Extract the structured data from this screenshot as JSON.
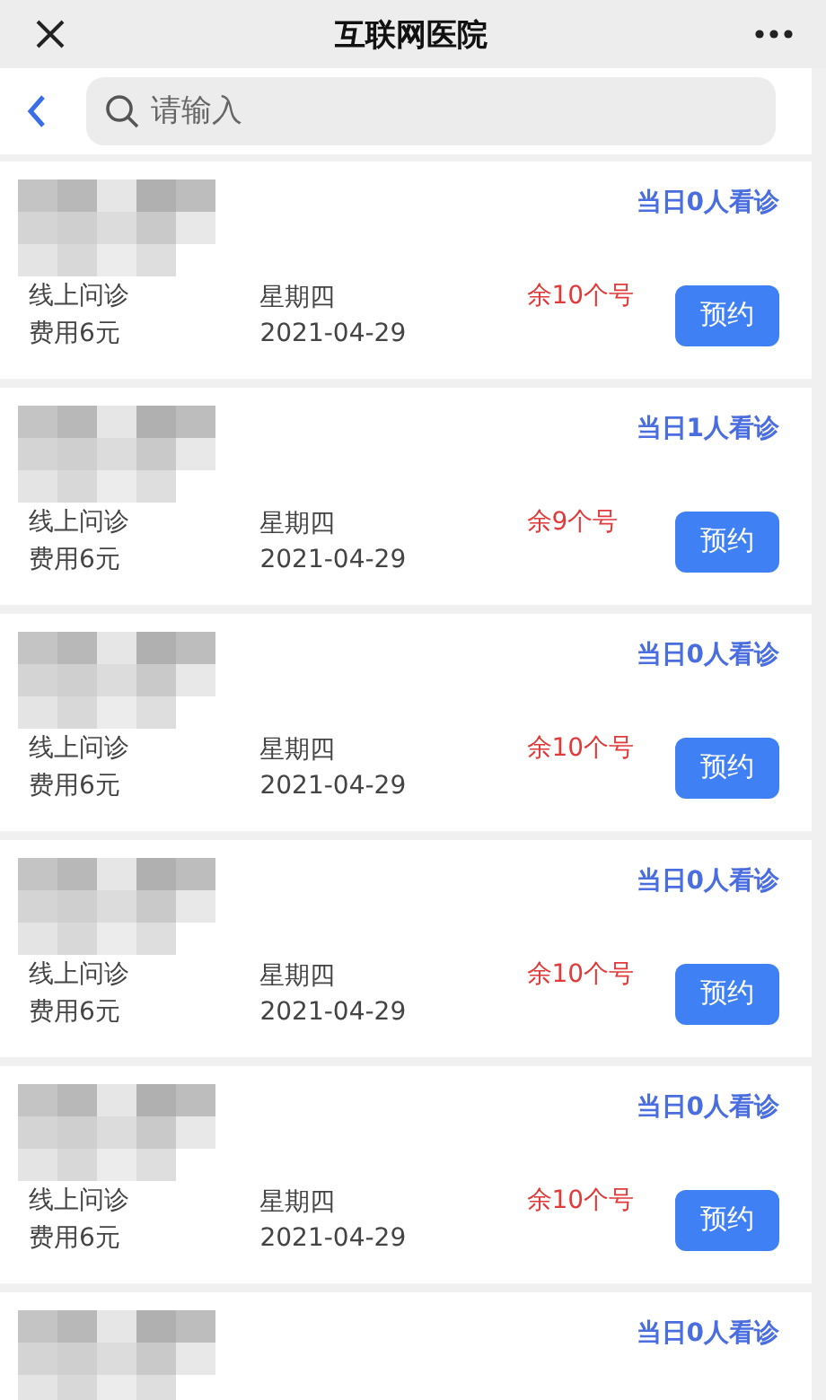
{
  "title_bar": {
    "title": "互联网医院"
  },
  "search": {
    "placeholder": "请输入"
  },
  "doctors": [
    {
      "today": "当日0人看诊",
      "type": "线上问诊",
      "fee": "费用6元",
      "weekday": "星期四",
      "date": "2021-04-29",
      "remaining": "余10个号",
      "button": "预约"
    },
    {
      "today": "当日1人看诊",
      "type": "线上问诊",
      "fee": "费用6元",
      "weekday": "星期四",
      "date": "2021-04-29",
      "remaining": "余9个号",
      "button": "预约"
    },
    {
      "today": "当日0人看诊",
      "type": "线上问诊",
      "fee": "费用6元",
      "weekday": "星期四",
      "date": "2021-04-29",
      "remaining": "余10个号",
      "button": "预约"
    },
    {
      "today": "当日0人看诊",
      "type": "线上问诊",
      "fee": "费用6元",
      "weekday": "星期四",
      "date": "2021-04-29",
      "remaining": "余10个号",
      "button": "预约"
    },
    {
      "today": "当日0人看诊",
      "type": "线上问诊",
      "fee": "费用6元",
      "weekday": "星期四",
      "date": "2021-04-29",
      "remaining": "余10个号",
      "button": "预约"
    },
    {
      "today": "当日0人看诊"
    }
  ]
}
